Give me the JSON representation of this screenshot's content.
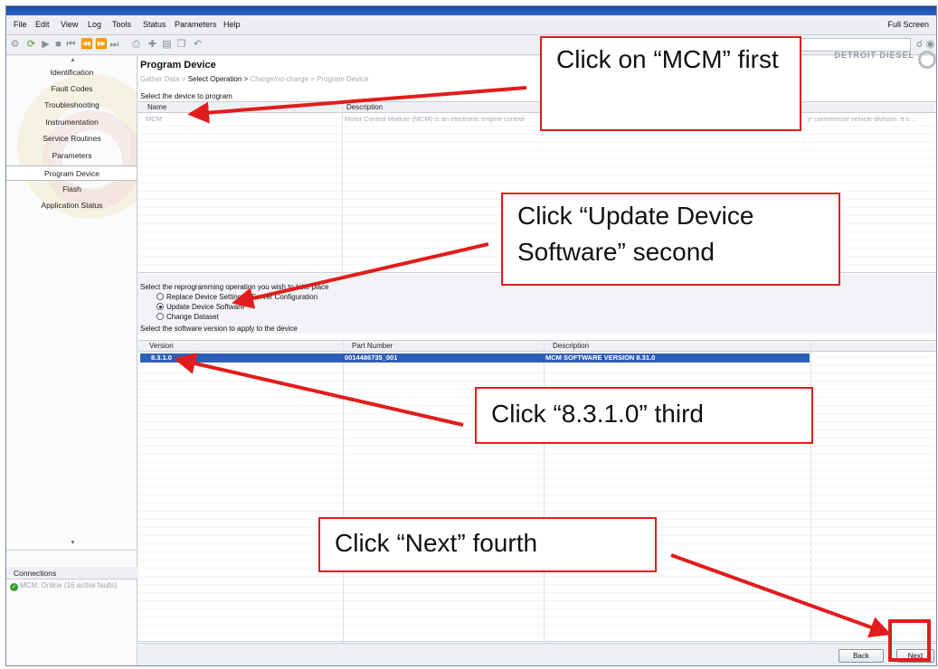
{
  "menu": [
    "File",
    "Edit",
    "View",
    "Log",
    "Tools",
    "Status",
    "Parameters",
    "Help"
  ],
  "full_screen_label": "Full Screen",
  "brand": {
    "name": "DETROIT DIESEL"
  },
  "sidebar": {
    "items": [
      "Identification",
      "Fault Codes",
      "Troubleshooting",
      "Instrumentation",
      "Service Routines",
      "Parameters",
      "Program Device",
      "Flash",
      "Application Status"
    ],
    "active": "Program Device"
  },
  "connections": {
    "header": "Connections",
    "item": "MCM: Online (16 active faults)"
  },
  "main": {
    "title": "Program Device",
    "breadcrumb": {
      "step1": "Gather Data >",
      "step2": "Select Operation >",
      "step3": "Charge/no-charge >",
      "step4": "Program Device"
    },
    "device_label": "Select the device to program",
    "device_table": {
      "col_name": "Name",
      "col_description": "Description",
      "row": {
        "name": "MCM",
        "description": "Motor Control Module (MCM) is an electronic engine control",
        "description_tail": "y' commercial vehicle division. It s..."
      }
    },
    "operation_label": "Select the reprogramming operation you wish to take place",
    "operations": [
      "Replace Device Settings / Server Configuration",
      "Update Device Software",
      "Change Dataset"
    ],
    "selected_operation": "Update Device Software",
    "software_label": "Select the software version to apply to the device",
    "software_table": {
      "col_version": "Version",
      "col_part": "Part Number",
      "col_description": "Description",
      "row": {
        "version": "8.3.1.0",
        "part": "0014486735_001",
        "description": "MCM SOFTWARE VERSION 8.31.0"
      }
    },
    "buttons": {
      "back": "Back",
      "next": "Next"
    }
  },
  "callouts": {
    "mcm": "Click on “MCM” first",
    "update": "Click “Update Device Software” second",
    "version": "Click “8.3.1.0” third",
    "next": "Click “Next” fourth"
  },
  "colors": {
    "annotation_red": "#e21c1c",
    "selection_blue": "#2e5fb8"
  }
}
